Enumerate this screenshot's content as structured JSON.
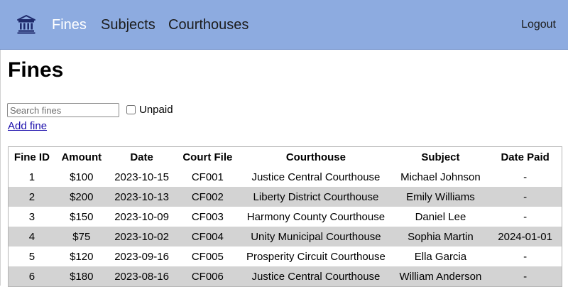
{
  "nav": {
    "logo_icon": "courthouse-icon",
    "links": [
      {
        "label": "Fines",
        "active": true
      },
      {
        "label": "Subjects",
        "active": false
      },
      {
        "label": "Courthouses",
        "active": false
      }
    ],
    "logout": "Logout"
  },
  "page": {
    "title": "Fines",
    "search_placeholder": "Search fines",
    "search_value": "",
    "unpaid_label": "Unpaid",
    "unpaid_checked": false,
    "add_link": "Add fine"
  },
  "table": {
    "headers": [
      "Fine ID",
      "Amount",
      "Date",
      "Court File",
      "Courthouse",
      "Subject",
      "Date Paid"
    ],
    "rows": [
      [
        "1",
        "$100",
        "2023-10-15",
        "CF001",
        "Justice Central Courthouse",
        "Michael Johnson",
        "-"
      ],
      [
        "2",
        "$200",
        "2023-10-13",
        "CF002",
        "Liberty District Courthouse",
        "Emily Williams",
        "-"
      ],
      [
        "3",
        "$150",
        "2023-10-09",
        "CF003",
        "Harmony County Courthouse",
        "Daniel Lee",
        "-"
      ],
      [
        "4",
        "$75",
        "2023-10-02",
        "CF004",
        "Unity Municipal Courthouse",
        "Sophia Martin",
        "2024-01-01"
      ],
      [
        "5",
        "$120",
        "2023-09-16",
        "CF005",
        "Prosperity Circuit Courthouse",
        "Ella Garcia",
        "-"
      ],
      [
        "6",
        "$180",
        "2023-08-16",
        "CF006",
        "Justice Central Courthouse",
        "William Anderson",
        "-"
      ]
    ]
  },
  "colors": {
    "navbar": "#8dabe0",
    "active_link": "#ffffff",
    "stripe": "#d3d3d3",
    "link": "#1a0dab"
  }
}
